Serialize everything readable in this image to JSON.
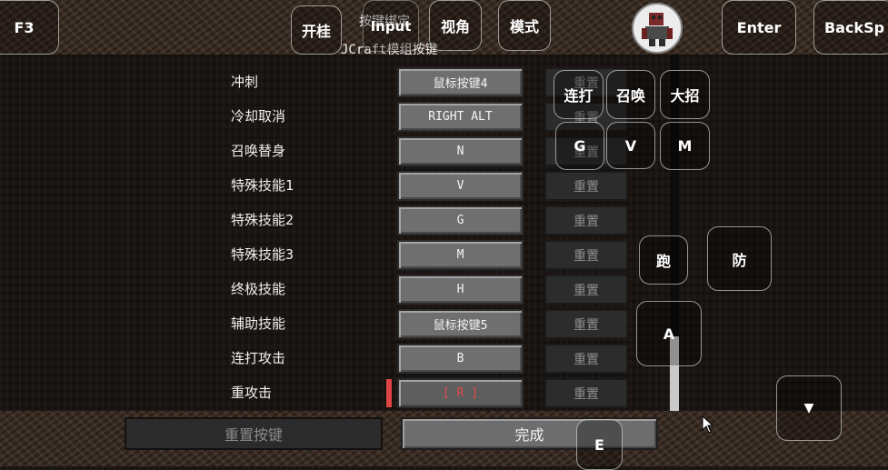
{
  "header": {
    "title": "按键绑定",
    "subtitle": "JCraft模组按键"
  },
  "bindings": [
    {
      "label": "冲刺",
      "key": "鼠标按键4",
      "reset": "重置"
    },
    {
      "label": "冷却取消",
      "key": "RIGHT ALT",
      "reset": "重置"
    },
    {
      "label": "召唤替身",
      "key": "N",
      "reset": "重置"
    },
    {
      "label": "特殊技能1",
      "key": "V",
      "reset": "重置"
    },
    {
      "label": "特殊技能2",
      "key": "G",
      "reset": "重置"
    },
    {
      "label": "特殊技能3",
      "key": "M",
      "reset": "重置"
    },
    {
      "label": "终极技能",
      "key": "H",
      "reset": "重置"
    },
    {
      "label": "辅助技能",
      "key": "鼠标按键5",
      "reset": "重置"
    },
    {
      "label": "连打攻击",
      "key": "B",
      "reset": "重置"
    },
    {
      "label": "重攻击",
      "key": "[ R ]",
      "reset": "重置"
    }
  ],
  "footer": {
    "reset_all": "重置按键",
    "done": "完成"
  },
  "overlay": {
    "f3": "F3",
    "guagui": "开桂",
    "input": "Input",
    "view": "视角",
    "mode": "模式",
    "enter": "Enter",
    "backspace": "BackSp",
    "combo": "连打",
    "summon": "召唤",
    "ultimate": "大招",
    "g": "G",
    "v": "V",
    "m": "M",
    "run": "跑",
    "defend": "防",
    "a": "A",
    "down": "▼",
    "e": "E"
  },
  "colors": {
    "selected_key": "#e04a4a",
    "key_button": "#6f6f6f",
    "reset_button": "#2c2c2c"
  },
  "icons": {
    "avatar": "player-avatar-icon",
    "cursor": "mouse-cursor-icon",
    "conflict": "conflict-marker"
  }
}
